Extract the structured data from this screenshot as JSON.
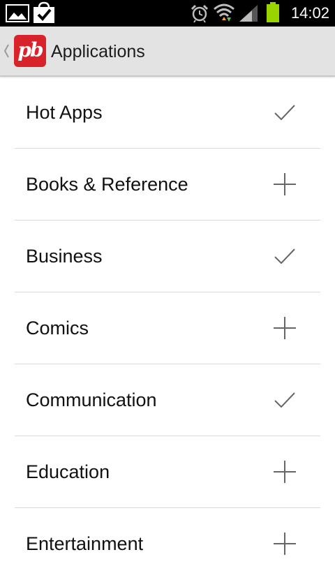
{
  "status_bar": {
    "time": "14:02",
    "icons": [
      "gallery-icon",
      "shopping-bag-check-icon",
      "alarm-icon",
      "wifi-icon",
      "signal-icon",
      "battery-icon"
    ],
    "battery_color": "#9ad400"
  },
  "action_bar": {
    "logo_text": "pb",
    "title": "Applications",
    "logo_color": "#d8232a"
  },
  "categories": [
    {
      "label": "Hot Apps",
      "state": "added",
      "icon": "checkmark-icon"
    },
    {
      "label": "Books & Reference",
      "state": "not-added",
      "icon": "plus-icon"
    },
    {
      "label": "Business",
      "state": "added",
      "icon": "checkmark-icon"
    },
    {
      "label": "Comics",
      "state": "not-added",
      "icon": "plus-icon"
    },
    {
      "label": "Communication",
      "state": "added",
      "icon": "checkmark-icon"
    },
    {
      "label": "Education",
      "state": "not-added",
      "icon": "plus-icon"
    },
    {
      "label": "Entertainment",
      "state": "not-added",
      "icon": "plus-icon"
    }
  ]
}
